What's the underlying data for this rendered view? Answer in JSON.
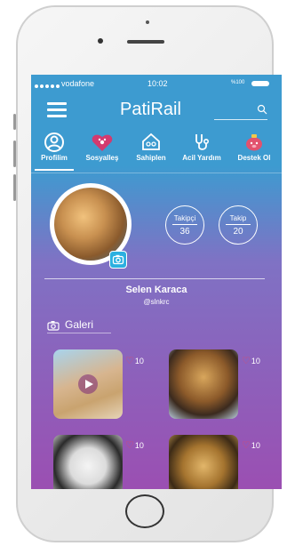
{
  "status_bar": {
    "carrier": "vodafone",
    "time": "10:02",
    "battery": "%100"
  },
  "app": {
    "title": "PatiRail"
  },
  "tabs": [
    {
      "label": "Profilim",
      "icon": "user-circle-icon"
    },
    {
      "label": "Sosyalleş",
      "icon": "heart-paw-icon"
    },
    {
      "label": "Sahiplen",
      "icon": "pet-home-icon"
    },
    {
      "label": "Acil Yardım",
      "icon": "stethoscope-icon"
    },
    {
      "label": "Destek Ol",
      "icon": "piggy-bank-icon"
    }
  ],
  "profile": {
    "name": "Selen Karaca",
    "handle": "@slnkrc",
    "followers_label": "Takipçi",
    "followers_count": "36",
    "following_label": "Takip",
    "following_count": "20"
  },
  "gallery": {
    "title": "Galeri",
    "items": [
      {
        "likes": "10",
        "type": "video"
      },
      {
        "likes": "10",
        "type": "photo"
      },
      {
        "likes": "10",
        "type": "photo"
      },
      {
        "likes": "10",
        "type": "photo"
      }
    ]
  },
  "colors": {
    "header_blue": "#3d9bd0",
    "bottom_purple": "#9b4fb2",
    "heart": "#e04a67",
    "camera_badge": "#2bb0e0"
  }
}
